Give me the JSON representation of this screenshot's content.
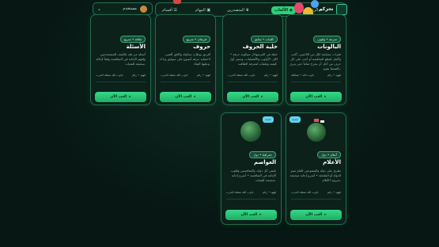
{
  "header": {
    "user_name": "مستخدم",
    "logo_text": "تحزكم",
    "nav": [
      {
        "label": "الرئيسية",
        "active": false
      },
      {
        "label": "الألعاب",
        "active": true
      },
      {
        "label": "المتصدرين",
        "active": false
      },
      {
        "label": "المهام",
        "active": false
      },
      {
        "label": "أقسام",
        "active": false
      }
    ]
  },
  "cards": [
    {
      "id": "balloons",
      "category": "سرعة • وقوف",
      "title": "البالونات",
      "description": "فقرات مسابقة لكل من اللاعبين، أكتب وأكمل لقطع المنافسة أو أجب على كل حرف من أجل أن يجرح تماماً حتى يترى بالضبط يقوم.",
      "meta_players": "فهود • رقم",
      "meta_mode": "جاوب الله • متناقلة",
      "play_label": "العب الآن"
    },
    {
      "id": "letter-cell",
      "category": "كلمات • سابق",
      "title": "خلية الحروف",
      "description": "خطة في الغرسهادل سيكونة حرفه • اكلر. الأولوب والأفضليات، ومميز أول كيفية وملفات لمعرفة الطاقت.",
      "meta_players": "فهود • رقم",
      "meta_mode": "جاوب الله متفلة الحرب",
      "play_label": "العب الآن"
    },
    {
      "id": "letters",
      "category": "فريقان • سريع",
      "title": "حروف",
      "description": "أفريق يوطارد محاولة وكافق أقصى لاحتفاية حرفة أسبوع على سوابق وبا ك وعليها البقاء.",
      "meta_players": "فهود • رقم",
      "meta_mode": "جاوب الله متفلة الحرب",
      "play_label": "العب الآن"
    },
    {
      "id": "questions",
      "category": "ثقافة • سريع",
      "title": "الأسئلة",
      "description": "أسئلة من فئة تكاشف للمستخدمين ولفهم الإجابة في المنافسة وفقاً لإحالة سحيقة للفتيات.",
      "meta_players": "فهود • رقم",
      "meta_mode": "جاوب الله متفلة الحرب",
      "play_label": "العب الآن"
    },
    {
      "id": "flags",
      "category": "أعلام • دول",
      "badge": "جديد",
      "title": "الأعلام",
      "description": "تطرق على دولة والمفتوحين للعام تتبيز الدولة أو الملحقة • أسرع إجابة صحيحة متروية الأقلام.",
      "meta_players": "فهود • رقم",
      "meta_mode": "جاوب الله متفلة الحرب",
      "play_label": "العب الآن"
    },
    {
      "id": "capitals",
      "category": "جغرافيا • دول",
      "badge": "جديد",
      "title": "العواصم",
      "description": "يلتمي كل دولة، والمنافسين وقلوب الإجابة في المنافسة • أسرع إجابة صحيحة للفتيات.",
      "meta_players": "فهود • رقم",
      "meta_mode": "جاوب الله متفلة الحرب",
      "play_label": "العب الآن"
    }
  ]
}
